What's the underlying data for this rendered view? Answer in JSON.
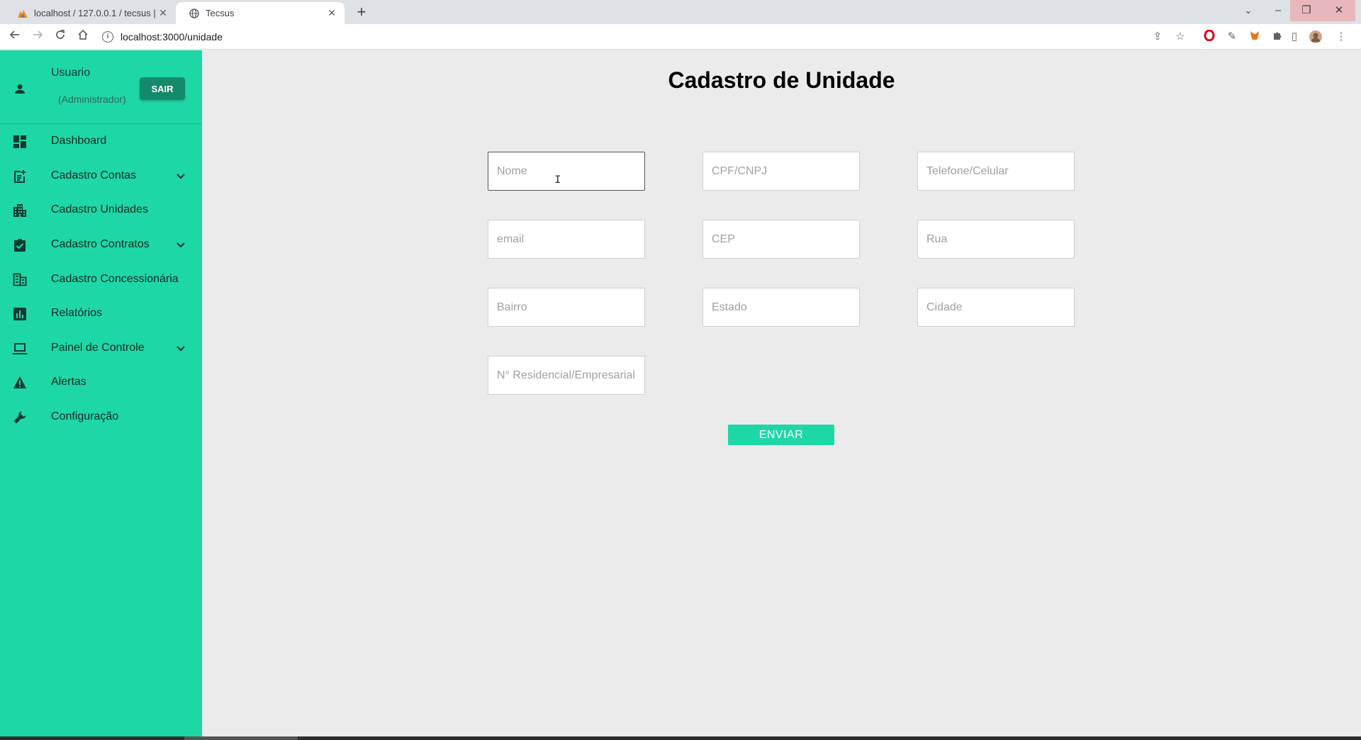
{
  "browser": {
    "tabs": [
      {
        "title": "localhost / 127.0.0.1 / tecsus | phpMyAdmin",
        "icon": "phpmyadmin-icon",
        "active": false
      },
      {
        "title": "Tecsus",
        "icon": "globe-icon",
        "active": true
      }
    ],
    "url": "localhost:3000/unidade"
  },
  "sidebar": {
    "user_name": "Usuario",
    "user_role": "(Administrador)",
    "logout_label": "SAIR",
    "items": [
      {
        "label": "Dashboard",
        "icon": "dashboard-icon",
        "has_submenu": false
      },
      {
        "label": "Cadastro Contas",
        "icon": "post-add-icon",
        "has_submenu": true
      },
      {
        "label": "Cadastro Unidades",
        "icon": "apartment-icon",
        "has_submenu": false
      },
      {
        "label": "Cadastro Contratos",
        "icon": "assignment-check-icon",
        "has_submenu": true
      },
      {
        "label": "Cadastro Concessionária",
        "icon": "business-icon",
        "has_submenu": false
      },
      {
        "label": "Relatórios",
        "icon": "bar-chart-icon",
        "has_submenu": false
      },
      {
        "label": "Painel de Controle",
        "icon": "laptop-icon",
        "has_submenu": true
      },
      {
        "label": "Alertas",
        "icon": "warning-icon",
        "has_submenu": false
      },
      {
        "label": "Configuração",
        "icon": "wrench-icon",
        "has_submenu": false
      }
    ]
  },
  "form": {
    "title": "Cadastro de Unidade",
    "fields": [
      {
        "placeholder": "Nome",
        "value": ""
      },
      {
        "placeholder": "CPF/CNPJ",
        "value": ""
      },
      {
        "placeholder": "Telefone/Celular",
        "value": ""
      },
      {
        "placeholder": "email",
        "value": ""
      },
      {
        "placeholder": "CEP",
        "value": ""
      },
      {
        "placeholder": "Rua",
        "value": ""
      },
      {
        "placeholder": "Bairro",
        "value": ""
      },
      {
        "placeholder": "Estado",
        "value": ""
      },
      {
        "placeholder": "Cidade",
        "value": ""
      },
      {
        "placeholder": "N° Residencial/Empresarial",
        "value": ""
      }
    ],
    "submit_label": "ENVIAR"
  },
  "colors": {
    "sidebar_bg": "#1ed7a6",
    "logout_bg": "#148a6a",
    "submit_bg": "#1ed7a6",
    "page_bg": "#ebebeb"
  }
}
